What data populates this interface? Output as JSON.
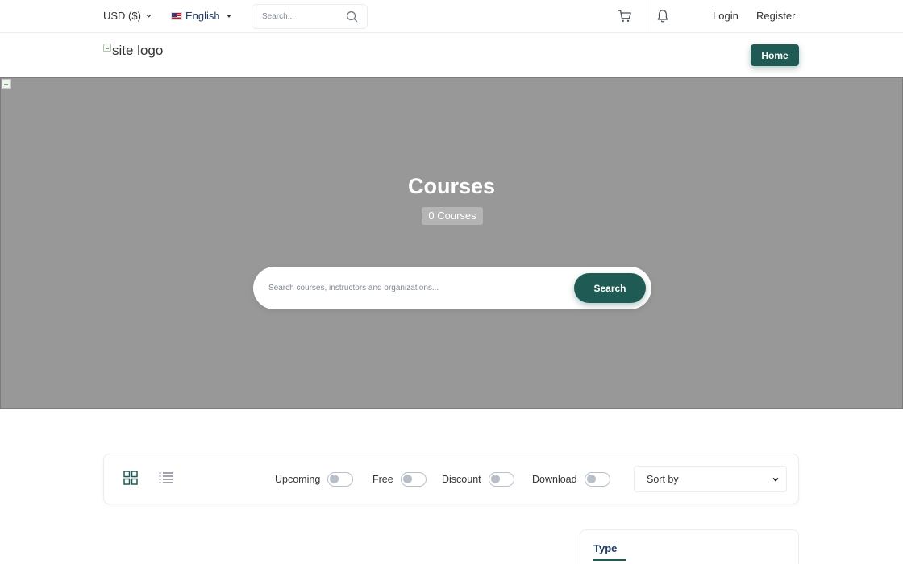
{
  "topbar": {
    "currency": "USD ($)",
    "language": "English",
    "search_placeholder": "Search...",
    "login": "Login",
    "register": "Register"
  },
  "nav": {
    "logo_alt": "site logo",
    "home": "Home"
  },
  "hero": {
    "title": "Courses",
    "count": "0 Courses",
    "search_placeholder": "Search courses, instructors and organizations...",
    "search_button": "Search"
  },
  "filters": {
    "toggles": [
      "Upcoming",
      "Free",
      "Discount",
      "Download"
    ],
    "sort_label": "Sort by"
  },
  "sidebar": {
    "type_title": "Type"
  },
  "colors": {
    "accent": "#1f5b54",
    "hero_bg": "#989898",
    "heading": "#1f3b64"
  }
}
